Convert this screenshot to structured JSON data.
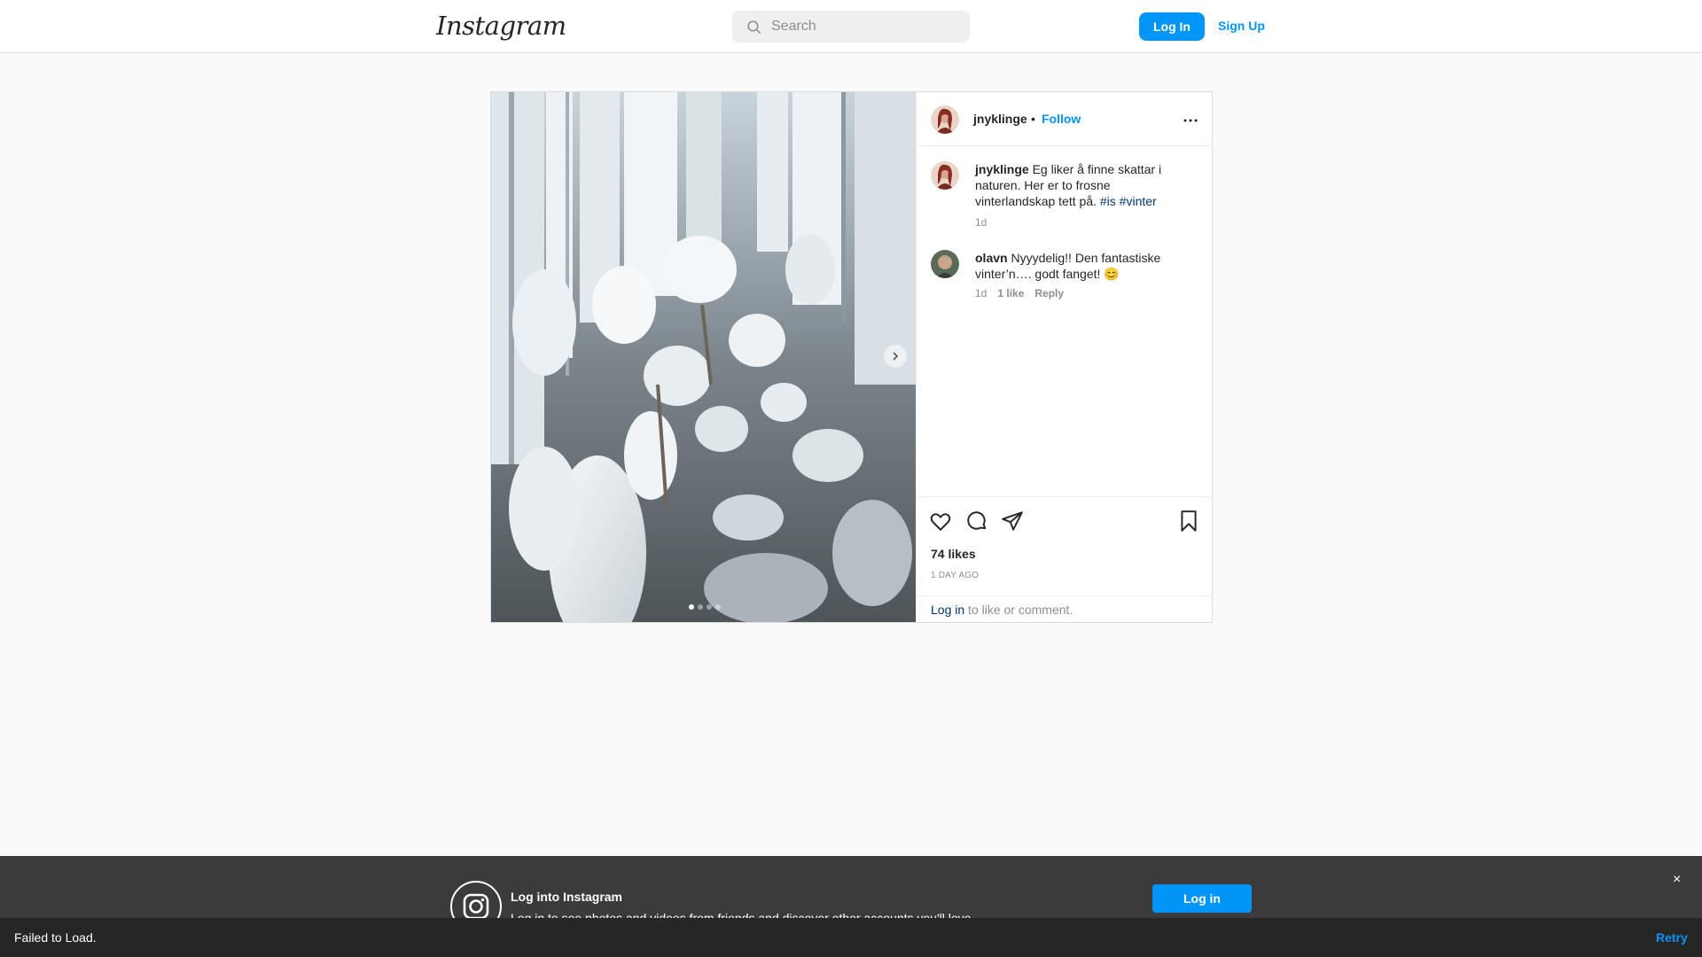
{
  "header": {
    "logo": "Instagram",
    "search_placeholder": "Search",
    "login_label": "Log In",
    "signup_label": "Sign Up"
  },
  "post": {
    "username": "jnyklinge",
    "separator": "•",
    "follow_label": "Follow",
    "more_icon": "more-horizontal-icon",
    "carousel": {
      "slide_count": 4,
      "active_slide": 1
    },
    "caption": {
      "username": "jnyklinge",
      "text": "Eg liker å finne skattar i naturen. Her er to frosne vinterlandskap tett på.",
      "tag1": "#is",
      "tag2": "#vinter",
      "age": "1d"
    },
    "comments": [
      {
        "username": "olavn",
        "text": "Nyyydelig!! Den fantastiske vinter’n…. godt fanget! 😊",
        "age": "1d",
        "likes": "1 like",
        "reply_label": "Reply"
      }
    ],
    "likes": "74 likes",
    "timestamp": "1 DAY AGO",
    "login_link": "Log in",
    "login_suffix": " to like or comment."
  },
  "banner": {
    "title": "Log into Instagram",
    "subtitle": "Log in to see photos and videos from friends and discover other accounts you'll love.",
    "button_label": "Log in",
    "close_label": "×"
  },
  "toast": {
    "message": "Failed to Load.",
    "retry_label": "Retry"
  },
  "colors": {
    "accent": "#0095f6",
    "hashtag": "#00376b",
    "banner_bg": "#3b3b3b",
    "toast_bg": "#262626"
  }
}
